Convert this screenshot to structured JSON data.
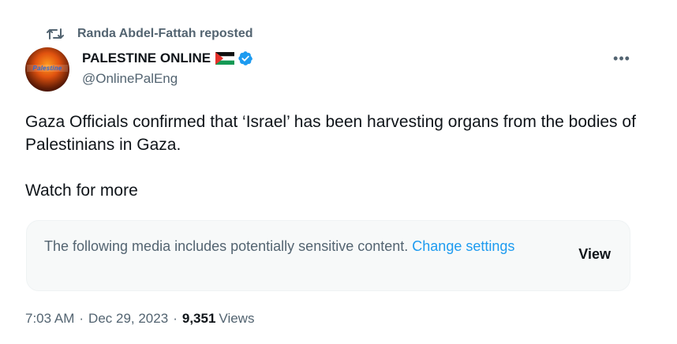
{
  "repost": {
    "label": "Randa Abdel-Fattah reposted",
    "icon": "repost-icon"
  },
  "author": {
    "avatar_text": "Palestine",
    "display_name": "PALESTINE ONLINE",
    "flag_icon": "palestine-flag-icon",
    "verified_icon": "verified-badge-icon",
    "handle": "@OnlinePalEng"
  },
  "more_icon": "more-options-icon",
  "tweet": {
    "paragraph_1": "Gaza Officials confirmed that ‘Israel’ has been harvesting organs from the bodies of Palestinians in Gaza.",
    "paragraph_2": "Watch for more"
  },
  "sensitive_notice": {
    "message": "The following media includes potentially sensitive content.",
    "link_text": "Change settings",
    "view_label": "View"
  },
  "meta": {
    "time": "7:03 AM",
    "date": "Dec 29, 2023",
    "views_count": "9,351",
    "views_label": "Views"
  },
  "colors": {
    "primary_text": "#0f1419",
    "secondary_text": "#536471",
    "accent_blue": "#1d9bf0",
    "notice_bg": "#f7f9f9"
  }
}
